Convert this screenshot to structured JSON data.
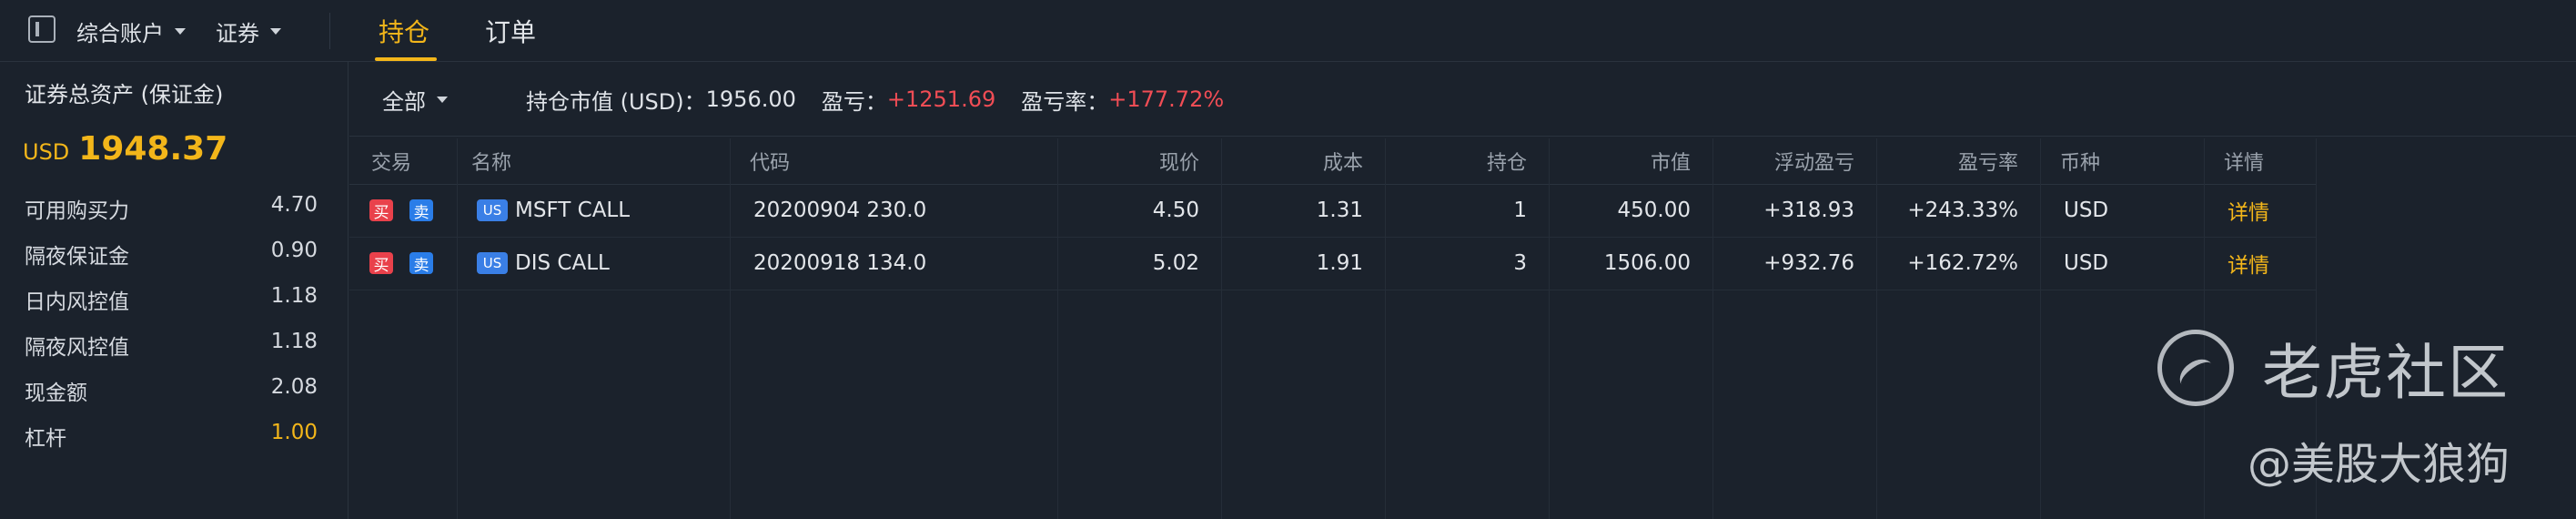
{
  "topbar": {
    "account_selector": "综合账户",
    "market_selector": "证券",
    "tabs": [
      {
        "label": "持仓",
        "active": true
      },
      {
        "label": "订单",
        "active": false
      }
    ]
  },
  "sidebar": {
    "assets_title": "证券总资产 (保证金)",
    "assets_currency": "USD",
    "assets_value": "1948.37",
    "metrics": [
      {
        "label": "可用购买力",
        "value": "4.70"
      },
      {
        "label": "隔夜保证金",
        "value": "0.90"
      },
      {
        "label": "日内风控值",
        "value": "1.18"
      },
      {
        "label": "隔夜风控值",
        "value": "1.18"
      },
      {
        "label": "现金额",
        "value": "2.08"
      },
      {
        "label": "杠杆",
        "value": "1.00"
      }
    ]
  },
  "filterbar": {
    "filter": "全部",
    "market_value_label": "持仓市值 (USD)：",
    "market_value": "1956.00",
    "pnl_label": "盈亏：",
    "pnl_value": "+1251.69",
    "pnl_rate_label": "盈亏率：",
    "pnl_rate_value": "+177.72%"
  },
  "table": {
    "columns": [
      "交易",
      "名称",
      "代码",
      "现价",
      "成本",
      "持仓",
      "市值",
      "浮动盈亏",
      "盈亏率",
      "币种",
      "详情"
    ],
    "buy_label": "买",
    "sell_label": "卖",
    "market_badge": "US",
    "rows": [
      {
        "name": "MSFT CALL",
        "code": "20200904 230.0",
        "price": "4.50",
        "cost": "1.31",
        "qty": "1",
        "value": "450.00",
        "pnl": "+318.93",
        "rate": "+243.33%",
        "currency": "USD",
        "detail": "详情"
      },
      {
        "name": "DIS CALL",
        "code": "20200918 134.0",
        "price": "5.02",
        "cost": "1.91",
        "qty": "3",
        "value": "1506.00",
        "pnl": "+932.76",
        "rate": "+162.72%",
        "currency": "USD",
        "detail": "详情"
      }
    ]
  },
  "watermark": {
    "line1": "老虎社区",
    "line2": "@美股大狼狗"
  },
  "colors": {
    "accent": "#f3b61a",
    "gain": "#f14d55",
    "background": "#1b222c"
  }
}
